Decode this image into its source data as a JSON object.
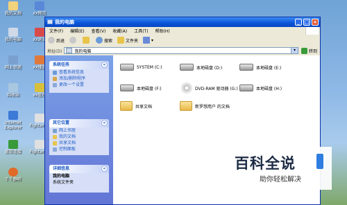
{
  "desktop": {
    "icons": [
      {
        "label": "我的文档",
        "color": "#f2d27a"
      },
      {
        "label": "xx网页",
        "color": "#5a88d8"
      },
      {
        "label": "我的电脑",
        "color": "#cfd9e8"
      },
      {
        "label": "xx浏览",
        "color": "#d84a4a"
      },
      {
        "label": "网上邻居",
        "color": "#7aa0d0"
      },
      {
        "label": "xx播放",
        "color": "#e07a3c"
      },
      {
        "label": "回收站",
        "color": "#a9c7e0"
      },
      {
        "label": "xx管理",
        "color": "#d8c03a"
      },
      {
        "label": "Internet Explorer",
        "color": "#3c7ad8"
      },
      {
        "label": "Fighter12",
        "color": "#e0e0e0"
      },
      {
        "label": "宽带连接",
        "color": "#3a9a3a"
      },
      {
        "label": "Fighter12",
        "color": "#e0e0e0"
      },
      {
        "label": "千千静听",
        "color": "#e06a2a"
      }
    ]
  },
  "window": {
    "title": "我的电脑",
    "menu": [
      "文件(F)",
      "编辑(E)",
      "查看(V)",
      "收藏(A)",
      "工具(T)",
      "帮助(H)"
    ],
    "toolbar": {
      "back": "后退",
      "search": "搜索",
      "folders": "文件夹"
    },
    "address": {
      "label": "地址(D)",
      "value": "我的电脑",
      "go": "转到"
    }
  },
  "taskpane": {
    "system_tasks": {
      "title": "系统任务",
      "items": [
        "查看系统信息",
        "添加/删除程序",
        "更改一个设置"
      ]
    },
    "other_places": {
      "title": "其它位置",
      "items": [
        "网上邻居",
        "我的文档",
        "共享文档",
        "控制面板"
      ]
    },
    "details": {
      "title": "详细信息",
      "name": "我的电脑",
      "desc": "系统文件夹"
    }
  },
  "content": {
    "drives": [
      {
        "label": "SYSTEM (C:)"
      },
      {
        "label": "本地磁盘 (D:)"
      },
      {
        "label": "本地磁盘 (E:)"
      },
      {
        "label": "本地磁盘 (F:)"
      },
      {
        "label": "DVD-RAM 驱动器 (G:)"
      },
      {
        "label": "本地磁盘 (H:)"
      }
    ],
    "folders": [
      {
        "label": "共享文档"
      },
      {
        "label": "新罗想用户 的文档"
      }
    ]
  },
  "watermark": {
    "title": "百科全说",
    "subtitle": "助你轻松解决"
  }
}
